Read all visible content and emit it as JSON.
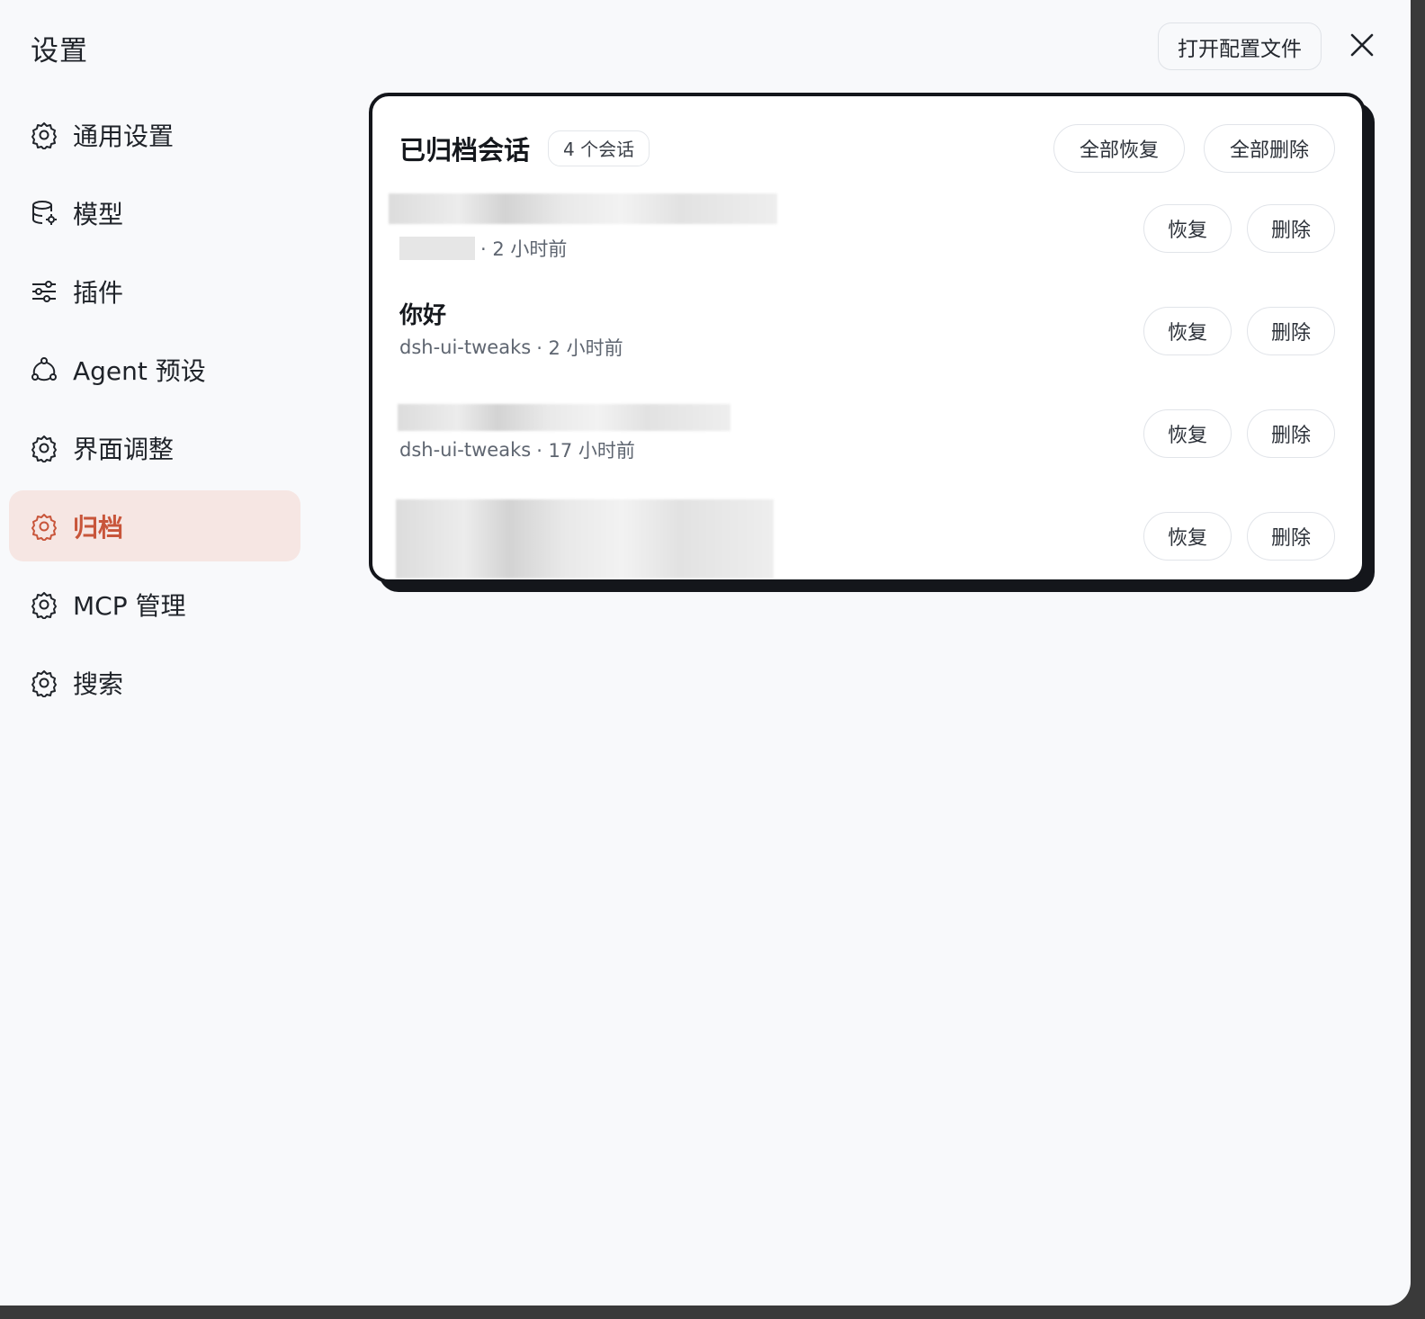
{
  "window": {
    "title": "设置",
    "open_config_label": "打开配置文件"
  },
  "sidebar": {
    "items": [
      {
        "label": "通用设置",
        "icon": "gear-icon"
      },
      {
        "label": "模型",
        "icon": "database-gear-icon"
      },
      {
        "label": "插件",
        "icon": "sliders-icon"
      },
      {
        "label": "Agent 预设",
        "icon": "agent-icon"
      },
      {
        "label": "界面调整",
        "icon": "gear-icon"
      },
      {
        "label": "归档",
        "icon": "gear-icon",
        "active": true
      },
      {
        "label": "MCP 管理",
        "icon": "gear-icon"
      },
      {
        "label": "搜索",
        "icon": "gear-icon"
      }
    ]
  },
  "archive": {
    "title": "已归档会话",
    "count_label": "4 个会话",
    "restore_all_label": "全部恢复",
    "delete_all_label": "全部删除",
    "restore_label": "恢复",
    "delete_label": "删除",
    "conversations": [
      {
        "title": "",
        "project": "",
        "time": "· 2 小时前"
      },
      {
        "title": "你好",
        "project": "dsh-ui-tweaks",
        "time": "· 2 小时前"
      },
      {
        "title": "",
        "project": "dsh-ui-tweaks",
        "time": "· 17 小时前"
      },
      {
        "title": "",
        "project": "",
        "time": ""
      }
    ]
  },
  "colors": {
    "accent": "#c8553a",
    "active_bg": "#f6e6e3",
    "panel_border": "#14161b"
  }
}
